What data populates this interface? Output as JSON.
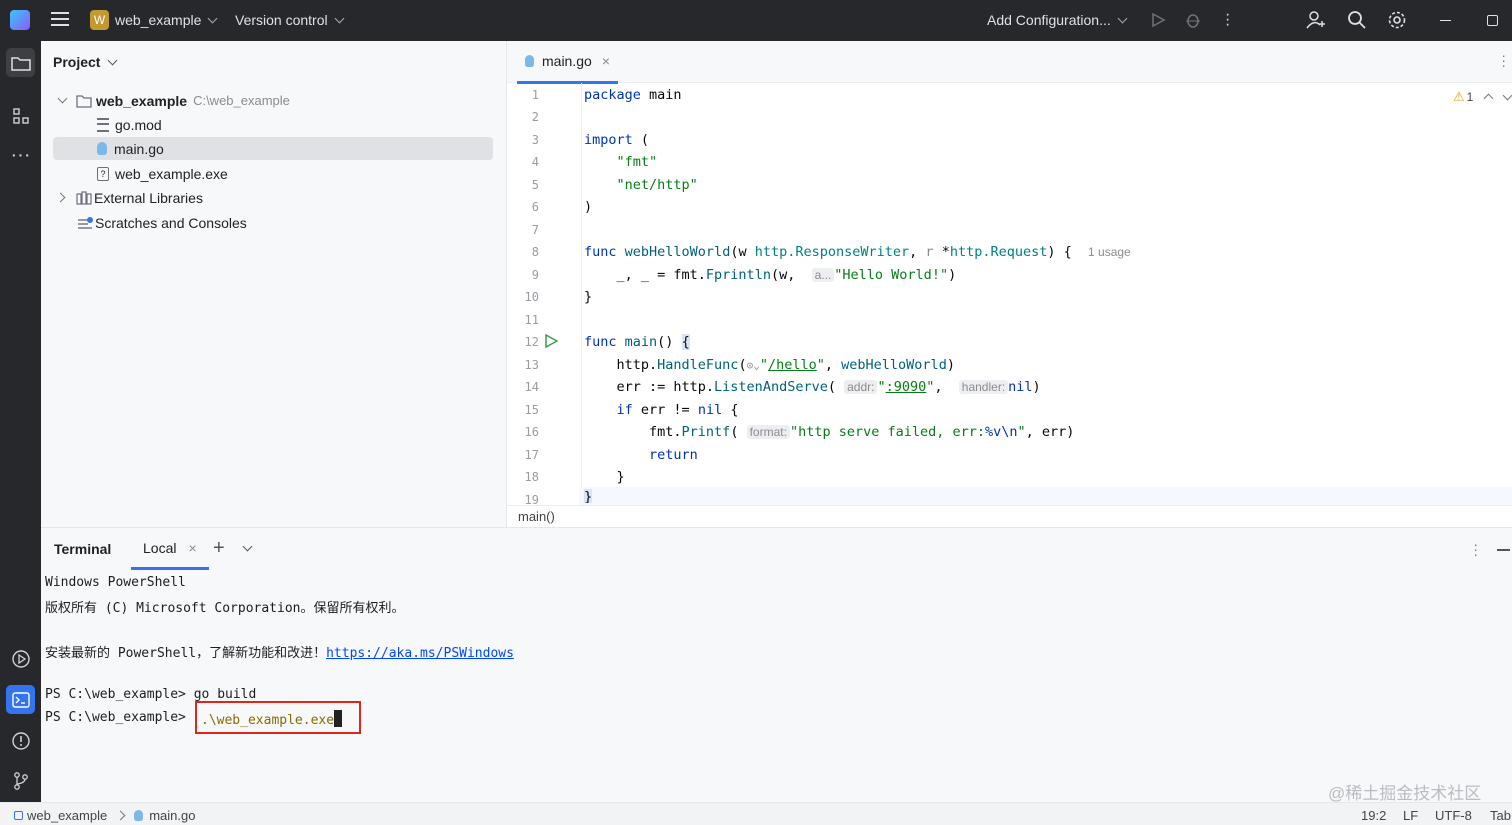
{
  "topbar": {
    "project_badge": "W",
    "project_name": "web_example",
    "vcs": "Version control",
    "run_config": "Add Configuration..."
  },
  "project_panel": {
    "title": "Project",
    "root": {
      "name": "web_example",
      "path": "C:\\web_example"
    },
    "files": [
      "go.mod",
      "main.go",
      "web_example.exe"
    ],
    "external": "External Libraries",
    "scratches": "Scratches and Consoles"
  },
  "editor": {
    "tab": "main.go",
    "warnings": "1",
    "line_numbers": [
      "1",
      "2",
      "3",
      "4",
      "5",
      "6",
      "7",
      "8",
      "9",
      "10",
      "11",
      "12",
      "13",
      "14",
      "15",
      "16",
      "17",
      "18",
      "19"
    ],
    "usage_hint": "1 usage",
    "hints": {
      "a": "a...",
      "addr": "addr:",
      "handler": "handler:",
      "format": "format:"
    },
    "breadcrumb": "main()"
  },
  "terminal": {
    "title": "Terminal",
    "tab": "Local",
    "lines": [
      "Windows PowerShell",
      "版权所有 (C) Microsoft Corporation。保留所有权利。",
      "",
      "安装最新的 PowerShell，了解新功能和改进！",
      "",
      "PS C:\\web_example> "
    ],
    "link": "https://aka.ms/PSWindows",
    "prompt": "PS C:\\web_example> ",
    "cmd1": "go build",
    "cmd2": ".\\web_example.exe"
  },
  "status": {
    "crumb_project": "web_example",
    "crumb_file": "main.go",
    "position": "19:2",
    "line_sep": "LF",
    "encoding": "UTF-8",
    "indent": "Tab",
    "watermark": "@稀土掘金技术社区"
  },
  "colors": {
    "highlight_box": "#e0261b",
    "accent": "#3574f0"
  }
}
